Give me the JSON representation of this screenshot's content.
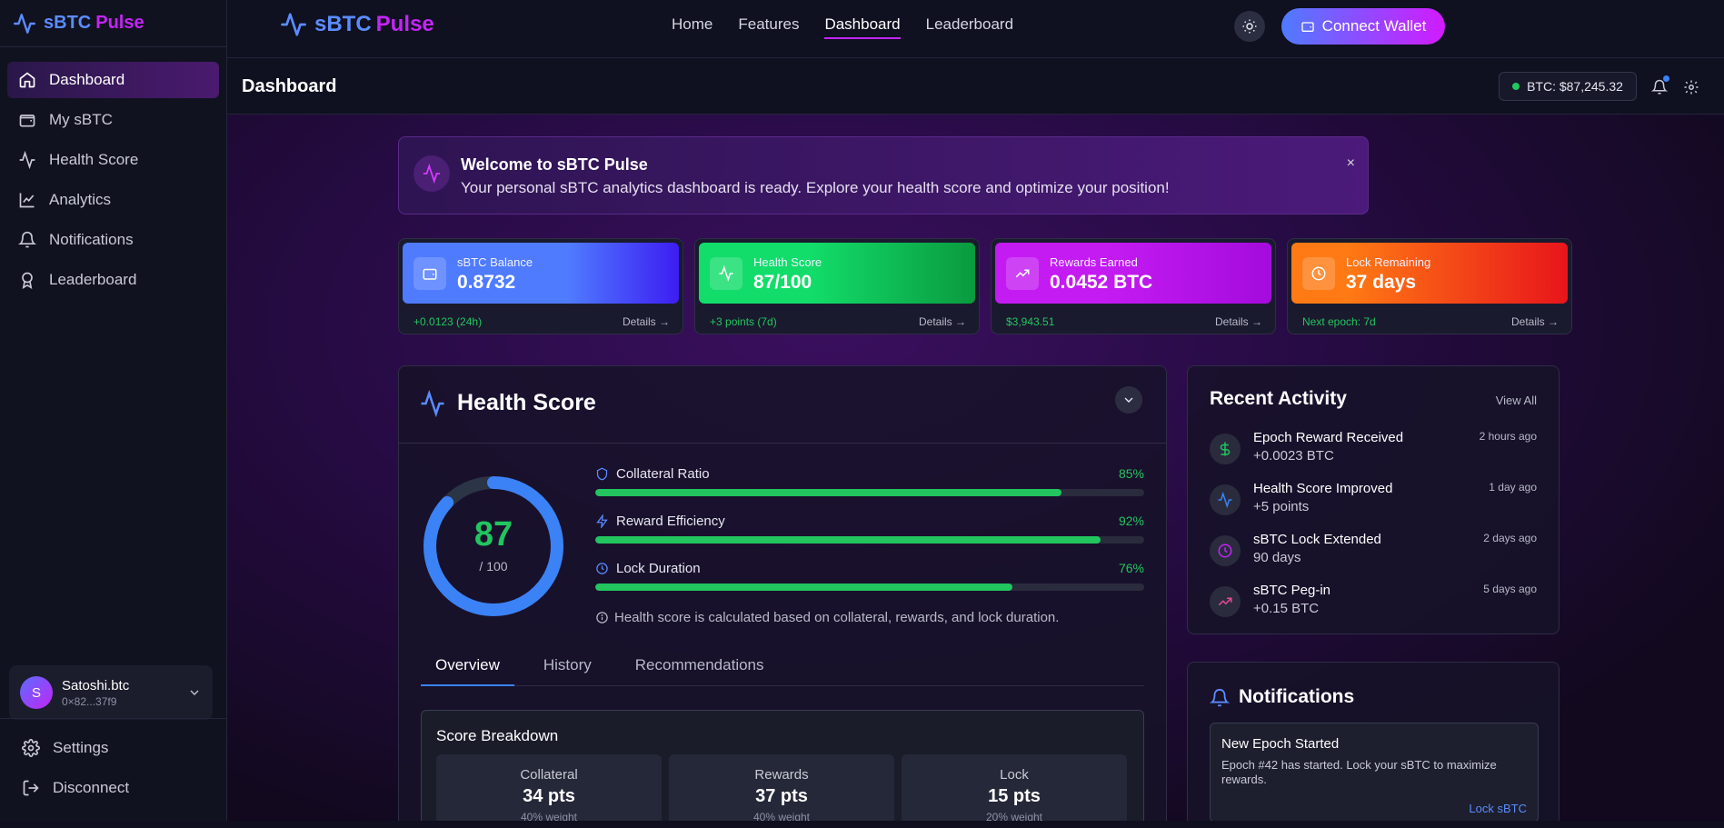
{
  "app": {
    "name_part1": "sBTC",
    "name_part2": "Pulse"
  },
  "sidebar": {
    "items": [
      {
        "label": "Dashboard",
        "icon": "home-icon"
      },
      {
        "label": "My sBTC",
        "icon": "wallet-icon"
      },
      {
        "label": "Health Score",
        "icon": "activity-icon"
      },
      {
        "label": "Analytics",
        "icon": "chart-line-icon"
      },
      {
        "label": "Notifications",
        "icon": "bell-icon"
      },
      {
        "label": "Leaderboard",
        "icon": "award-icon"
      }
    ],
    "user": {
      "initial": "S",
      "name": "Satoshi.btc",
      "address": "0×82...37f9"
    },
    "settings_label": "Settings",
    "disconnect_label": "Disconnect"
  },
  "topbar": {
    "nav": [
      "Home",
      "Features",
      "Dashboard",
      "Leaderboard"
    ],
    "connect_label": "Connect Wallet"
  },
  "header": {
    "title": "Dashboard",
    "btc_price": "BTC: $87,245.32"
  },
  "welcome": {
    "title": "Welcome to sBTC Pulse",
    "text": "Your personal sBTC analytics dashboard is ready. Explore your health score and optimize your position!",
    "close": "×"
  },
  "stats": [
    {
      "label": "sBTC Balance",
      "value": "0.8732",
      "foot": "+0.0123 (24h)",
      "details": "Details →",
      "color_from": "#4f7bff",
      "color_to": "#3d1df2"
    },
    {
      "label": "Health Score",
      "value": "87/100",
      "foot": "+3 points (7d)",
      "details": "Details →",
      "color_from": "#12dd6a",
      "color_to": "#0a9a3f"
    },
    {
      "label": "Rewards Earned",
      "value": "0.0452 BTC",
      "foot": "$3,943.51",
      "details": "Details →",
      "color_from": "#c41bf2",
      "color_to": "#a40bdc"
    },
    {
      "label": "Lock Remaining",
      "value": "37 days",
      "foot": "Next epoch: 7d",
      "details": "Details →",
      "color_from": "#ff7a14",
      "color_to": "#e8151b"
    }
  ],
  "health": {
    "title": "Health Score",
    "score": "87",
    "score_of": "/ 100",
    "score_fraction": 0.87,
    "metrics": [
      {
        "label": "Collateral Ratio",
        "pct": "85%",
        "value": 85,
        "icon": "shield-icon"
      },
      {
        "label": "Reward Efficiency",
        "pct": "92%",
        "value": 92,
        "icon": "bolt-icon"
      },
      {
        "label": "Lock Duration",
        "pct": "76%",
        "value": 76,
        "icon": "clock-icon"
      }
    ],
    "note": "Health score is calculated based on collateral, rewards, and lock duration.",
    "tabs": [
      "Overview",
      "History",
      "Recommendations"
    ],
    "breakdown": {
      "title": "Score Breakdown",
      "cells": [
        {
          "name": "Collateral",
          "value": "34 pts",
          "weight": "40% weight"
        },
        {
          "name": "Rewards",
          "value": "37 pts",
          "weight": "40% weight"
        },
        {
          "name": "Lock",
          "value": "15 pts",
          "weight": "20% weight"
        }
      ]
    }
  },
  "activity": {
    "title": "Recent Activity",
    "view_all": "View All",
    "items": [
      {
        "title": "Epoch Reward Received",
        "sub": "+0.0023 BTC",
        "time": "2 hours ago",
        "icon": "dollar-icon",
        "color": "#22c55e"
      },
      {
        "title": "Health Score Improved",
        "sub": "+5 points",
        "time": "1 day ago",
        "icon": "activity-icon",
        "color": "#3b82f6"
      },
      {
        "title": "sBTC Lock Extended",
        "sub": "90 days",
        "time": "2 days ago",
        "icon": "clock-icon",
        "color": "#c325f5"
      },
      {
        "title": "sBTC Peg-in",
        "sub": "+0.15 BTC",
        "time": "5 days ago",
        "icon": "trending-up-icon",
        "color": "#ec4899"
      }
    ]
  },
  "notifications": {
    "title": "Notifications",
    "item": {
      "title": "New Epoch Started",
      "body": "Epoch #42 has started. Lock your sBTC to maximize rewards.",
      "link": "Lock sBTC"
    }
  }
}
